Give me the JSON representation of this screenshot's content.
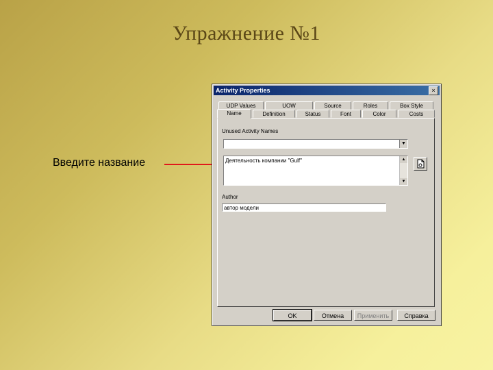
{
  "slide": {
    "title": "Упражнение №1",
    "callout": "Введите название"
  },
  "dialog": {
    "title": "Activity Properties",
    "close_glyph": "×",
    "tabs_back": [
      "UDP Values",
      "UOW",
      "Source",
      "Roles",
      "Box Style"
    ],
    "tabs_front": [
      "Name",
      "Definition",
      "Status",
      "Font",
      "Color",
      "Costs"
    ],
    "active_tab": "Name",
    "unused_label": "Unused Activity Names",
    "unused_value": "",
    "name_value": "Деятельность компании \"Gulf\"",
    "author_label": "Author",
    "author_value": "автор модели",
    "buttons": {
      "ok": "OK",
      "cancel": "Отмена",
      "apply": "Применить",
      "help": "Справка"
    }
  },
  "colors": {
    "titlebar": "#0a246a",
    "arrow": "#e0191b",
    "window": "#d4d0c8"
  }
}
